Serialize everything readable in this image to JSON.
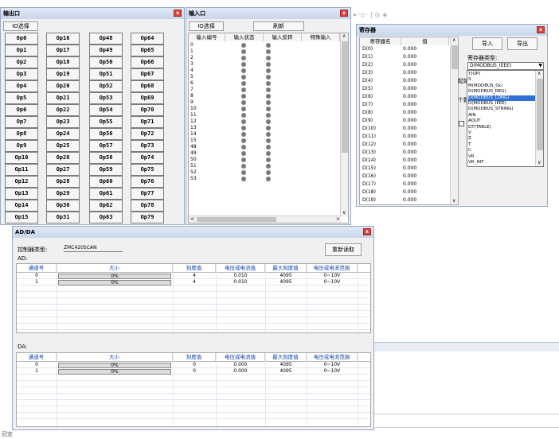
{
  "toolbar_glyphs": "▸◦▫◦ | ◎ ◈",
  "io_output": {
    "title": "输出口",
    "close": "x",
    "select_button": "IO选择",
    "columns": [
      [
        "Op0",
        "Op1",
        "Op2",
        "Op3",
        "Op4",
        "Op5",
        "Op6",
        "Op7",
        "Op8",
        "Op9",
        "Op10",
        "Op11",
        "Op12",
        "Op13",
        "Op14",
        "Op15"
      ],
      [
        "Op16",
        "Op17",
        "Op18",
        "Op19",
        "Op20",
        "Op21",
        "Op22",
        "Op23",
        "Op24",
        "Op25",
        "Op26",
        "Op27",
        "Op28",
        "Op29",
        "Op30",
        "Op31"
      ],
      [
        "Op48",
        "Op49",
        "Op50",
        "Op51",
        "Op52",
        "Op53",
        "Op54",
        "Op55",
        "Op56",
        "Op57",
        "Op58",
        "Op59",
        "Op60",
        "Op61",
        "Op62",
        "Op63"
      ],
      [
        "Op64",
        "Op65",
        "Op66",
        "Op67",
        "Op68",
        "Op69",
        "Op70",
        "Op71",
        "Op72",
        "Op73",
        "Op74",
        "Op75",
        "Op76",
        "Op77",
        "Op78",
        "Op79"
      ]
    ]
  },
  "io_input": {
    "title": "输入口",
    "close": "x",
    "select_button": "IO选择",
    "refresh_button": "刷新",
    "headers": [
      "输入编号",
      "输入状态",
      "输入反转",
      "特殊输入"
    ],
    "rows": [
      "0",
      "1",
      "2",
      "3",
      "4",
      "5",
      "6",
      "7",
      "8",
      "9",
      "10",
      "11",
      "12",
      "13",
      "14",
      "15",
      "48",
      "49",
      "50",
      "51",
      "52",
      "53"
    ]
  },
  "register": {
    "title": "寄存器",
    "close": "x",
    "headers": [
      "寄存器名",
      "值"
    ],
    "rows": [
      [
        "D(0)",
        "0.000"
      ],
      [
        "D(1)",
        "0.000"
      ],
      [
        "D(2)",
        "0.000"
      ],
      [
        "D(3)",
        "0.000"
      ],
      [
        "D(4)",
        "0.000"
      ],
      [
        "D(5)",
        "0.000"
      ],
      [
        "D(6)",
        "0.000"
      ],
      [
        "D(7)",
        "0.000"
      ],
      [
        "D(8)",
        "0.000"
      ],
      [
        "D(9)",
        "0.000"
      ],
      [
        "D(10)",
        "0.000"
      ],
      [
        "D(11)",
        "0.000"
      ],
      [
        "D(12)",
        "0.000"
      ],
      [
        "D(13)",
        "0.000"
      ],
      [
        "D(14)",
        "0.000"
      ],
      [
        "D(15)",
        "0.000"
      ],
      [
        "D(16)",
        "0.000"
      ],
      [
        "D(17)",
        "0.000"
      ],
      [
        "D(18)",
        "0.000"
      ],
      [
        "D(19)",
        "0.000"
      ]
    ],
    "import_button": "导入",
    "export_button": "导出",
    "type_label": "寄存器类型:",
    "selected_type": "D(MODBUS_IEEE)",
    "start_label_partial": "起始",
    "count_label_partial": "个数",
    "options": [
      "Y(OP)",
      "S",
      "M(MODBUS_0x)",
      "D(MODBUS_REG)",
      "D(MODBUS_LONG)",
      "D(MODBUS_IEEE)",
      "D(MODBUS_STRING)",
      "AIN",
      "AOUT",
      "DT(TABLE)",
      "V",
      "Z",
      "T",
      "C",
      "VR",
      "VR_INT"
    ],
    "highlighted_option": "D(MODBUS_LONG)"
  },
  "adda": {
    "title": "AD/DA",
    "close": "x",
    "controller_label": "控制器类型:",
    "controller_value": "ZMC420SCAN",
    "reread_button": "重新读取",
    "ad_label": "AD:",
    "da_label": "DA:",
    "headers": [
      "通道号",
      "大小",
      "刻度值",
      "电压或电流值",
      "最大刻度值",
      "电压或电流范围"
    ],
    "ad_rows": [
      {
        "ch": "0",
        "size": "0%",
        "scale": "4",
        "value": "0.010",
        "max": "4095",
        "range": "0~10V",
        "fill": 0
      },
      {
        "ch": "1",
        "size": "0%",
        "scale": "4",
        "value": "0.010",
        "max": "4095",
        "range": "0~10V",
        "fill": 0
      }
    ],
    "da_rows": [
      {
        "ch": "0",
        "size": "0%",
        "scale": "0",
        "value": "0.000",
        "max": "4095",
        "range": "0~10V",
        "fill": 0
      },
      {
        "ch": "1",
        "size": "0%",
        "scale": "0",
        "value": "0.000",
        "max": "4095",
        "range": "0~10V",
        "fill": 0
      }
    ]
  },
  "bottom_fragment": "冠宣"
}
